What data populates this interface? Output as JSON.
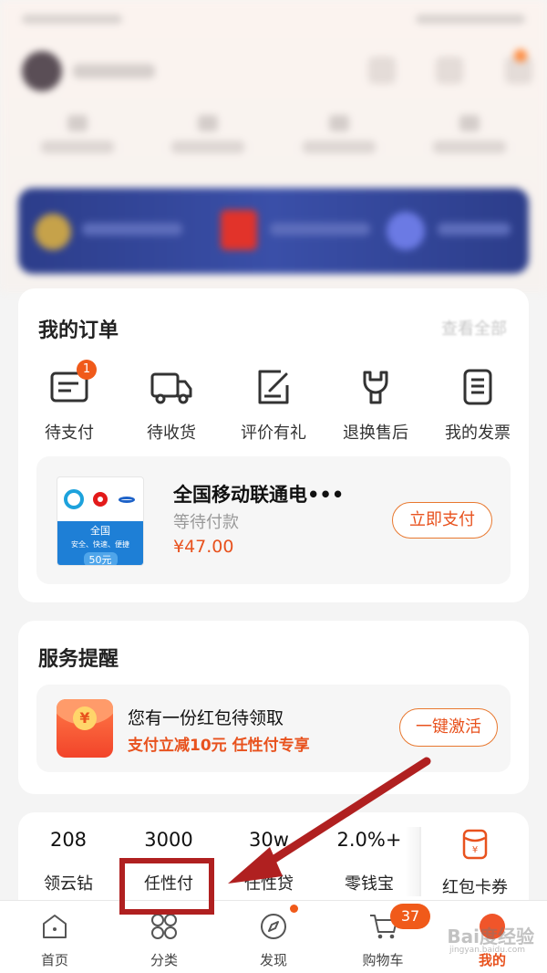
{
  "orders": {
    "title": "我的订单",
    "view_all": "查看全部",
    "items": [
      {
        "label": "待支付",
        "badge": "1"
      },
      {
        "label": "待收货"
      },
      {
        "label": "评价有礼"
      },
      {
        "label": "退换售后"
      },
      {
        "label": "我的发票"
      }
    ],
    "pending": {
      "card_line1": "全国",
      "card_line2": "安全、快速、便捷",
      "card_line3": "50元",
      "title": "全国移动联通电•••",
      "status": "等待付款",
      "price": "¥47.00",
      "pay_label": "立即支付"
    }
  },
  "service": {
    "title": "服务提醒",
    "message": "您有一份红包待领取",
    "subtitle": "支付立减10元 任性付专享",
    "activate_label": "一键激活",
    "coin": "¥"
  },
  "finance": {
    "items": [
      {
        "value": "208",
        "label": "领云钻"
      },
      {
        "value": "3000",
        "label": "任性付"
      },
      {
        "value": "30w",
        "label": "任性贷"
      },
      {
        "value": "2.0%+",
        "label": "零钱宝"
      },
      {
        "value": "",
        "label": "红包卡券",
        "icon": "red-envelope-coupon-icon"
      }
    ]
  },
  "nav": {
    "items": [
      {
        "label": "首页",
        "icon": "home-icon"
      },
      {
        "label": "分类",
        "icon": "category-icon"
      },
      {
        "label": "发现",
        "icon": "compass-icon"
      },
      {
        "label": "购物车",
        "icon": "cart-icon",
        "badge": "37"
      },
      {
        "label": "我的",
        "icon": "mine-icon",
        "active": true
      }
    ]
  },
  "watermark": {
    "text": "Bai度经验",
    "sub": "jingyan.baidu.com"
  },
  "colors": {
    "accent": "#e8521e",
    "badge": "#f05a1a",
    "annotation": "#b02020"
  }
}
